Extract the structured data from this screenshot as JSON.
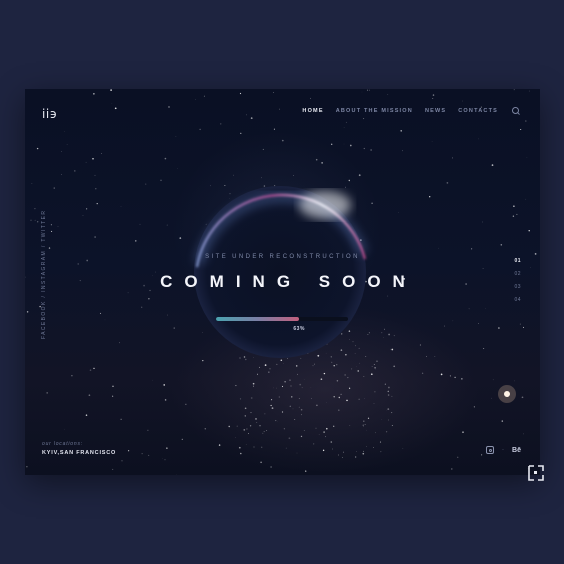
{
  "brand": {
    "logo_text": "ii϶"
  },
  "nav": {
    "items": [
      {
        "label": "HOME",
        "active": true
      },
      {
        "label": "ABOUT THE MISSION",
        "active": false
      },
      {
        "label": "NEWS",
        "active": false
      },
      {
        "label": "CONTACTS",
        "active": false
      }
    ],
    "search_icon": "search-icon"
  },
  "social_vertical": {
    "facebook": "FACEBOOK",
    "separator": " / ",
    "instagram": "INSTAGRAM",
    "twitter": "TWITTER"
  },
  "hero": {
    "subtitle": "SITE UNDER RECONSTRUCTION",
    "headline": "COMING SOON",
    "progress_label": "63%",
    "progress_value": 0.63
  },
  "pager": {
    "items": [
      "01",
      "02",
      "03",
      "04"
    ],
    "active_index": 0
  },
  "footer": {
    "locations_label": "our locations:",
    "locations_value": "KYIV,SAN FRANCISCO",
    "behance_label": "Bē",
    "separator": "·"
  },
  "colors": {
    "background": "#1e2440",
    "panel": "#0c1329",
    "progress_start": "#4ba3b0",
    "progress_end": "#c2607e",
    "accent_rim": "#d0508a"
  }
}
